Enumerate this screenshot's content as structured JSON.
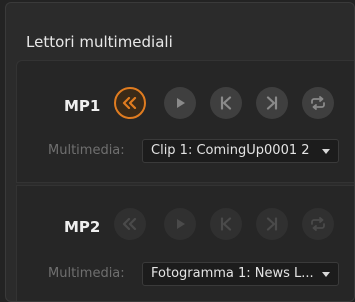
{
  "panel": {
    "title": "Lettori multimediali"
  },
  "players": [
    {
      "label": "MP1",
      "field_label": "Multimedia:",
      "selected_media": "Clip 1: ComingUp0001 2",
      "controls": [
        "rewind-icon",
        "play-icon",
        "previous-icon",
        "next-icon",
        "loop-icon"
      ],
      "active_control": "rewind-icon"
    },
    {
      "label": "MP2",
      "field_label": "Multimedia:",
      "selected_media": "Fotogramma 1: News L...",
      "controls": [
        "rewind-icon",
        "play-icon",
        "previous-icon",
        "next-icon",
        "loop-icon"
      ],
      "active_control": ""
    }
  ],
  "colors": {
    "accent": "#e07c20",
    "panel_bg": "#2b2b2b",
    "text": "#e8e8e8",
    "muted_text": "#6f6f6f"
  }
}
